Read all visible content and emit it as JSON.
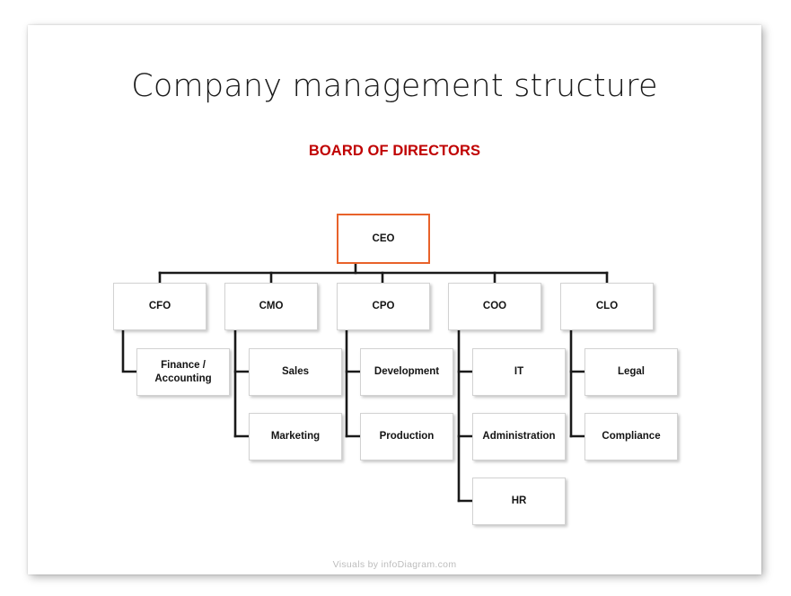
{
  "slide": {
    "title": "Company management structure",
    "board_label": "BOARD OF DIRECTORS",
    "footer": "Visuals by infoDiagram.com",
    "accent_color": "#E8622A",
    "board_color": "#C00000",
    "connector_color": "#1a1a1a",
    "box_border_color": "#d2d2d2"
  },
  "chart_data": {
    "type": "org-chart",
    "title": "Company management structure",
    "root": {
      "id": "ceo",
      "label": "CEO",
      "highlighted": true
    },
    "levels": [
      {
        "level": 1,
        "nodes": [
          {
            "id": "ceo",
            "label": "CEO",
            "parent": null
          }
        ]
      },
      {
        "level": 2,
        "nodes": [
          {
            "id": "cfo",
            "label": "CFO",
            "parent": "ceo"
          },
          {
            "id": "cmo",
            "label": "CMO",
            "parent": "ceo"
          },
          {
            "id": "cpo",
            "label": "CPO",
            "parent": "ceo"
          },
          {
            "id": "coo",
            "label": "COO",
            "parent": "ceo"
          },
          {
            "id": "clo",
            "label": "CLO",
            "parent": "ceo"
          }
        ]
      },
      {
        "level": 3,
        "nodes": [
          {
            "id": "finance",
            "label": "Finance / Accounting",
            "parent": "cfo"
          },
          {
            "id": "sales",
            "label": "Sales",
            "parent": "cmo"
          },
          {
            "id": "marketing",
            "label": "Marketing",
            "parent": "cmo"
          },
          {
            "id": "development",
            "label": "Development",
            "parent": "cpo"
          },
          {
            "id": "production",
            "label": "Production",
            "parent": "cpo"
          },
          {
            "id": "it",
            "label": "IT",
            "parent": "coo"
          },
          {
            "id": "administration",
            "label": "Administration",
            "parent": "coo"
          },
          {
            "id": "hr",
            "label": "HR",
            "parent": "coo"
          },
          {
            "id": "legal",
            "label": "Legal",
            "parent": "clo"
          },
          {
            "id": "compliance",
            "label": "Compliance",
            "parent": "clo"
          }
        ]
      }
    ]
  },
  "nodes": {
    "ceo": "CEO",
    "cfo": "CFO",
    "cmo": "CMO",
    "cpo": "CPO",
    "coo": "COO",
    "clo": "CLO",
    "finance_line1": "Finance /",
    "finance_line2": "Accounting",
    "sales": "Sales",
    "marketing": "Marketing",
    "development": "Development",
    "production": "Production",
    "it": "IT",
    "administration": "Administration",
    "hr": "HR",
    "legal": "Legal",
    "compliance": "Compliance"
  }
}
